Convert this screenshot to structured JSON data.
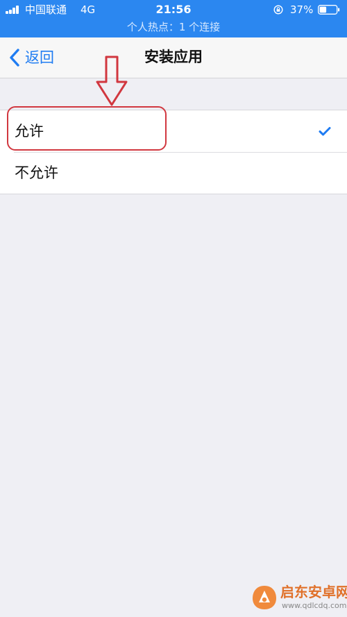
{
  "status_bar": {
    "carrier": "中国联通",
    "network": "4G",
    "time": "21:56",
    "battery_percent": "37%",
    "icons": [
      "signal-icon",
      "orientation-lock-icon",
      "battery-icon"
    ]
  },
  "hotspot_banner": {
    "text": "个人热点：1 个连接"
  },
  "nav": {
    "back_label": "返回",
    "title": "安装应用"
  },
  "options": [
    {
      "label": "允许",
      "selected": true
    },
    {
      "label": "不允许",
      "selected": false
    }
  ],
  "watermark": {
    "name": "启东安卓网",
    "url": "www.qdlcdq.com"
  },
  "colors": {
    "status_bg": "#2b87f0",
    "accent": "#1f7cf2",
    "annotation": "#d1373f",
    "background": "#efeff4"
  }
}
